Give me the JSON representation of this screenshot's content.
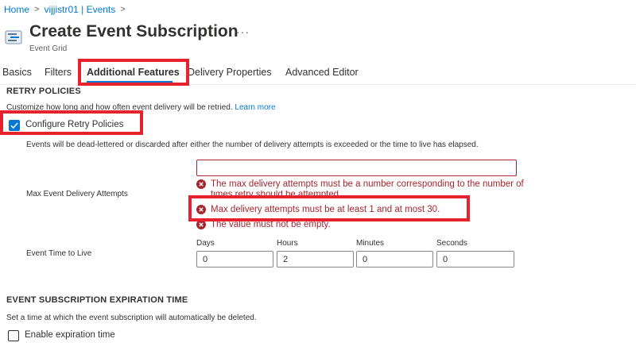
{
  "breadcrumb": {
    "home": "Home",
    "parent": "vijjistr01 | Events"
  },
  "header": {
    "title": "Create Event Subscription",
    "ellipsis": "···",
    "subtitle": "Event Grid"
  },
  "tabs": [
    {
      "label": "Basics"
    },
    {
      "label": "Filters"
    },
    {
      "label": "Additional Features"
    },
    {
      "label": "Delivery Properties"
    },
    {
      "label": "Advanced Editor"
    }
  ],
  "retry": {
    "heading": "RETRY POLICIES",
    "description": "Customize how long and how often event delivery will be retried.",
    "learn_more": "Learn more",
    "checkbox_label": "Configure Retry Policies",
    "checked": true,
    "note": "Events will be dead-lettered or discarded after either the number of delivery attempts is exceeded or the time to live has elapsed.",
    "max_attempts_label": "Max Event Delivery Attempts",
    "max_attempts_value": "",
    "errors": [
      "The max delivery attempts must be a number corresponding to the number of",
      "times retry should be attempted.",
      "Max delivery attempts must be at least 1 and at most 30.",
      "The value must not be empty."
    ],
    "ttl_label": "Event Time to Live",
    "ttl": {
      "days_label": "Days",
      "days": "0",
      "hours_label": "Hours",
      "hours": "2",
      "minutes_label": "Minutes",
      "minutes": "0",
      "seconds_label": "Seconds",
      "seconds": "0"
    }
  },
  "expiration": {
    "heading": "EVENT SUBSCRIPTION EXPIRATION TIME",
    "description": "Set a time at which the event subscription will automatically be deleted.",
    "checkbox_label": "Enable expiration time",
    "checked": false
  },
  "colors": {
    "accent": "#0078d4",
    "error": "#a4262c",
    "highlight": "#e7212d"
  }
}
